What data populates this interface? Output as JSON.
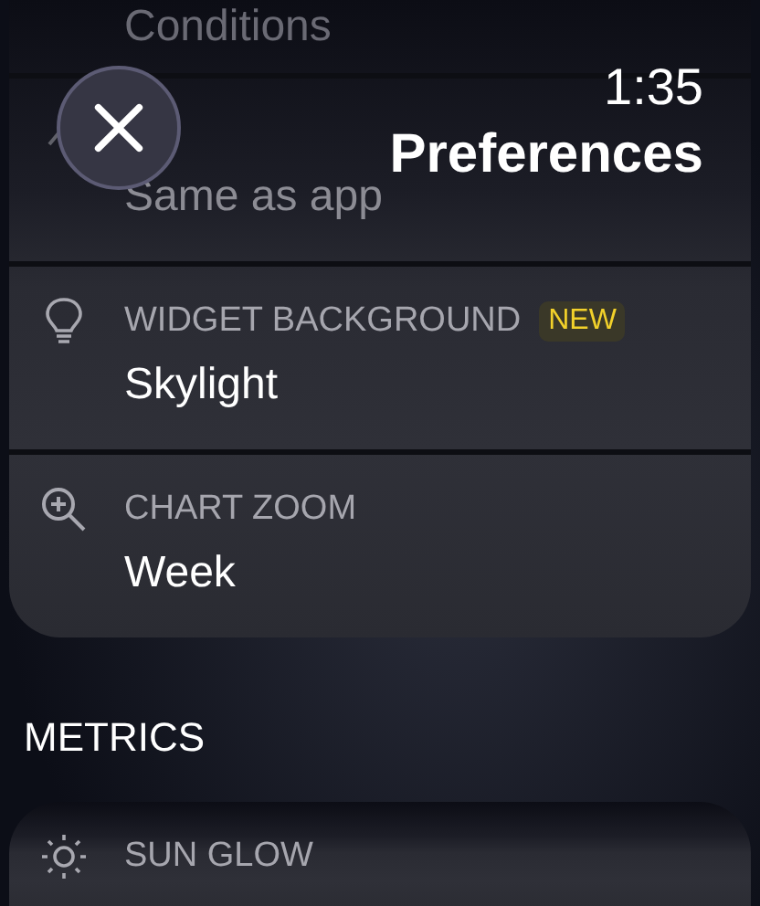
{
  "header": {
    "time": "1:35",
    "title": "Preferences"
  },
  "settings": [
    {
      "kind": "value_only",
      "value": "Conditions"
    },
    {
      "kind": "setting",
      "value": "Same as app"
    },
    {
      "kind": "setting",
      "label": "WIDGET BACKGROUND",
      "badge": "NEW",
      "value": "Skylight"
    },
    {
      "kind": "setting",
      "label": "CHART ZOOM",
      "value": "Week"
    }
  ],
  "metrics": {
    "title": "METRICS",
    "items": [
      {
        "kind": "setting",
        "label": "SUN GLOW"
      }
    ]
  }
}
